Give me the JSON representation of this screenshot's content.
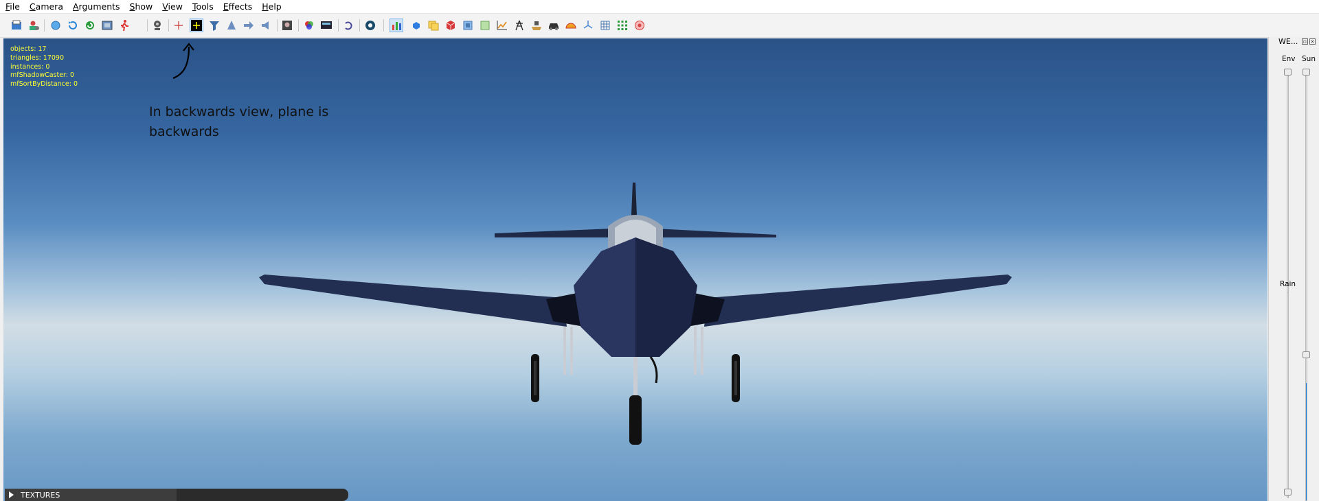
{
  "menu": [
    {
      "label": "File",
      "ul": "F",
      "rest": "ile"
    },
    {
      "label": "Camera",
      "ul": "C",
      "rest": "amera"
    },
    {
      "label": "Arguments",
      "ul": "A",
      "rest": "rguments"
    },
    {
      "label": "Show",
      "ul": "S",
      "rest": "how"
    },
    {
      "label": "View",
      "ul": "V",
      "rest": "iew"
    },
    {
      "label": "Tools",
      "ul": "T",
      "rest": "ools"
    },
    {
      "label": "Effects",
      "ul": "E",
      "rest": "ffects"
    },
    {
      "label": "Help",
      "ul": "H",
      "rest": "elp"
    }
  ],
  "stats": [
    "objects: 17",
    "triangles: 17090",
    "instances: 0",
    "mfShadowCaster: 0",
    "mfSortByDistance: 0"
  ],
  "annotation": "In backwards view, plane is backwards",
  "textures_label": "TEXTURES",
  "panel": {
    "title": "WE...",
    "env_label": "Env",
    "sun_label": "Sun",
    "rain_label": "Rain"
  },
  "sliders": {
    "env": 0.0,
    "sun": 0.0,
    "rain": 0.0,
    "sun_lower": 0.6
  },
  "colors": {
    "accent": "#1b7fe0",
    "stats_text": "#ffff33"
  }
}
